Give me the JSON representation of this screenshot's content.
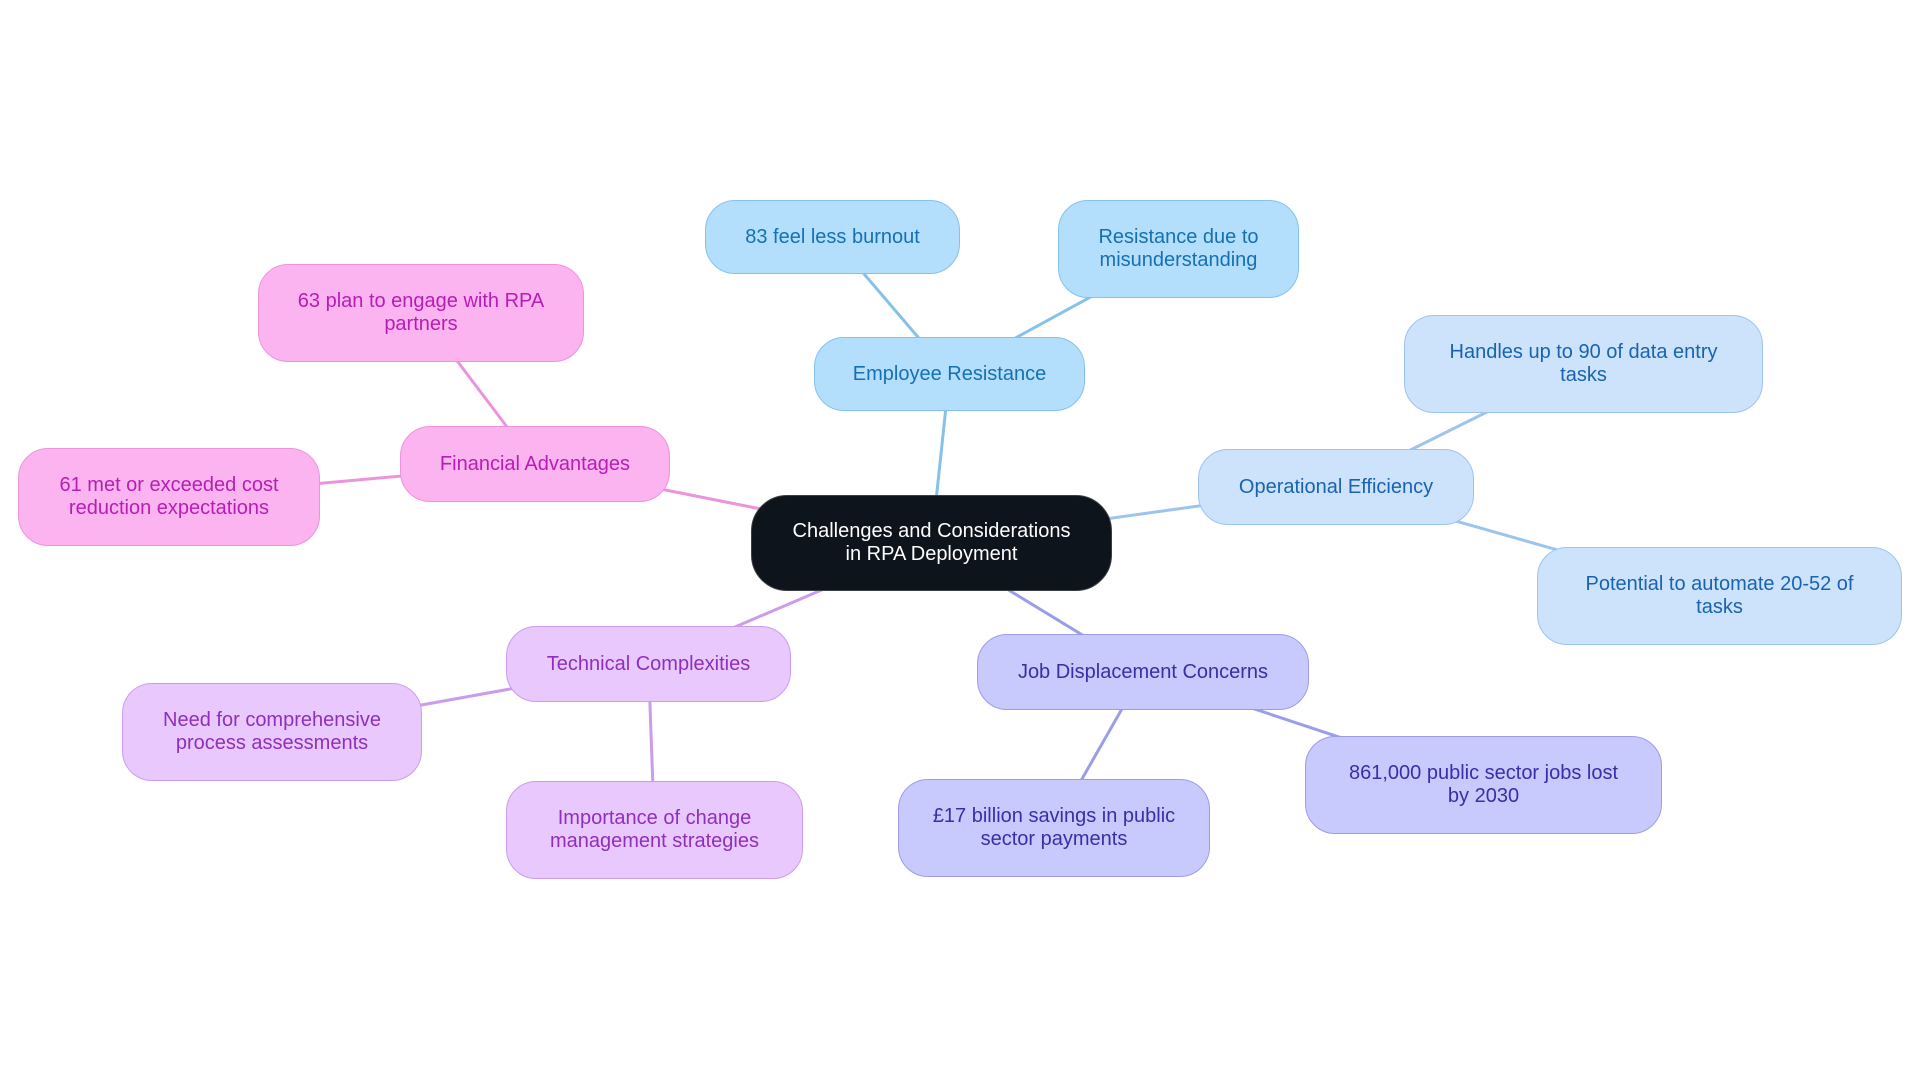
{
  "diagram": {
    "type": "mindmap",
    "root": {
      "id": "root",
      "label": "Challenges and Considerations in RPA Deployment",
      "lines": [
        "Challenges and Considerations",
        "in RPA Deployment"
      ]
    },
    "branches": [
      {
        "id": "employee-resistance",
        "label": "Employee Resistance",
        "color_fill": "#b4dffc",
        "color_edge": "#86c1ea",
        "color_text": "#1670b3",
        "children": [
          {
            "id": "less-burnout",
            "label": "83 feel less burnout"
          },
          {
            "id": "resistance-misunderstanding",
            "label": "Resistance due to misunderstanding",
            "lines": [
              "Resistance due to",
              "misunderstanding"
            ]
          }
        ]
      },
      {
        "id": "operational-efficiency",
        "label": "Operational Efficiency",
        "color_fill": "#cde3fb",
        "color_edge": "#9dc4ee",
        "color_text": "#1a63b2",
        "children": [
          {
            "id": "data-entry",
            "label": "Handles up to 90 of data entry tasks",
            "lines": [
              "Handles up to 90 of data entry",
              "tasks"
            ]
          },
          {
            "id": "automate-tasks",
            "label": "Potential to automate 20-52 of tasks",
            "lines": [
              "Potential to automate 20-52 of",
              "tasks"
            ]
          }
        ]
      },
      {
        "id": "job-displacement",
        "label": "Job Displacement Concerns",
        "color_fill": "#c8c9fd",
        "color_edge": "#9c9de8",
        "color_text": "#3a2fa8",
        "children": [
          {
            "id": "savings",
            "label": "£17 billion savings in public sector payments",
            "lines": [
              "£17 billion savings in public",
              "sector payments"
            ]
          },
          {
            "id": "jobs-lost",
            "label": "861,000 public sector jobs lost by 2030",
            "lines": [
              "861,000 public sector jobs lost",
              "by 2030"
            ]
          }
        ]
      },
      {
        "id": "technical-complexities",
        "label": "Technical Complexities",
        "color_fill": "#e9c9fd",
        "color_edge": "#cc9cec",
        "color_text": "#8e2fc0",
        "children": [
          {
            "id": "process-assessments",
            "label": "Need for comprehensive process assessments",
            "lines": [
              "Need for comprehensive",
              "process assessments"
            ]
          },
          {
            "id": "change-management",
            "label": "Importance of change management strategies",
            "lines": [
              "Importance of change",
              "management strategies"
            ]
          }
        ]
      },
      {
        "id": "financial-advantages",
        "label": "Financial Advantages",
        "color_fill": "#fcb4f1",
        "color_edge": "#eb93dd",
        "color_text": "#b81db3",
        "children": [
          {
            "id": "rpa-partners",
            "label": "63 plan to engage with RPA partners",
            "lines": [
              "63 plan to engage with RPA",
              "partners"
            ]
          },
          {
            "id": "cost-reduction",
            "label": "61 met or exceeded cost reduction expectations",
            "lines": [
              "61 met or exceeded cost",
              "reduction expectations"
            ]
          }
        ]
      }
    ]
  }
}
